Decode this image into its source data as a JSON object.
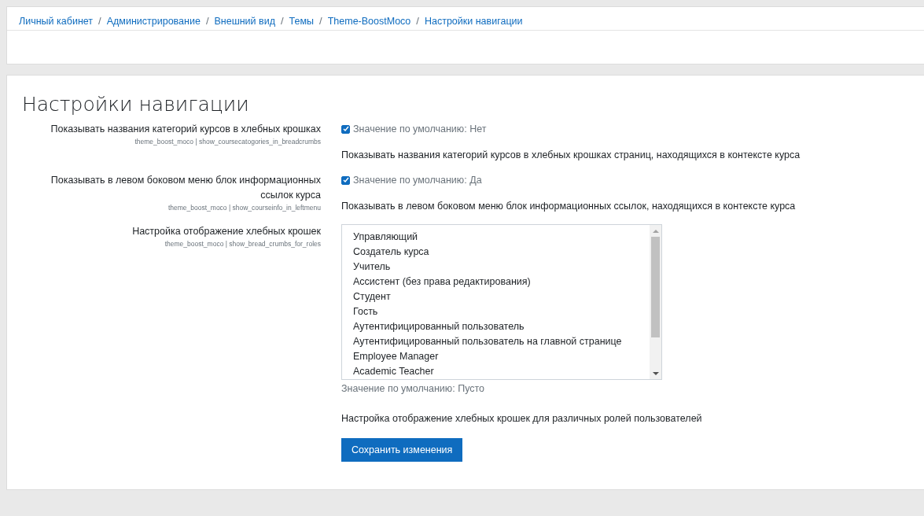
{
  "breadcrumbs": [
    {
      "label": "Личный кабинет"
    },
    {
      "label": "Администрирование"
    },
    {
      "label": "Внешний вид"
    },
    {
      "label": "Темы"
    },
    {
      "label": "Theme-BoostMoco"
    },
    {
      "label": "Настройки навигации"
    }
  ],
  "breadcrumb_separator": "/",
  "heading": "Настройки навигации",
  "settings": [
    {
      "kind": "checkbox",
      "label": "Показывать названия категорий курсов в хлебных крошках",
      "key": "theme_boost_moco | show_coursecatogories_in_breadcrumbs",
      "checked": true,
      "default": "Значение по умолчанию: Нет",
      "description": "Показывать названия категорий курсов в хлебных крошках страниц, находящихся в контексте курса"
    },
    {
      "kind": "checkbox",
      "label": "Показывать в левом боковом меню блок информационных ссылок курса",
      "key": "theme_boost_moco | show_courseinfo_in_leftmenu",
      "checked": true,
      "default": "Значение по умолчанию: Да",
      "description": "Показывать в левом боковом меню блок информационных ссылок, находящихся в контексте курса"
    },
    {
      "kind": "multiselect",
      "label": "Настройка отображение хлебных крошек",
      "key": "theme_boost_moco | show_bread_crumbs_for_roles",
      "options": [
        {
          "label": "Управляющий",
          "selected": false
        },
        {
          "label": "Создатель курса",
          "selected": false
        },
        {
          "label": "Учитель",
          "selected": false
        },
        {
          "label": "Ассистент (без права редактирования)",
          "selected": false
        },
        {
          "label": "Студент",
          "selected": false
        },
        {
          "label": "Гость",
          "selected": false
        },
        {
          "label": "Аутентифицированный пользователь",
          "selected": false
        },
        {
          "label": "Аутентифицированный пользователь на главной странице",
          "selected": false
        },
        {
          "label": "Employee Manager",
          "selected": false
        },
        {
          "label": "Academic Teacher",
          "selected": false
        }
      ],
      "default": "Значение по умолчанию: Пусто",
      "description": "Настройка отображение хлебных крошек для различных ролей пользователей"
    }
  ],
  "save_button": "Сохранить изменения"
}
